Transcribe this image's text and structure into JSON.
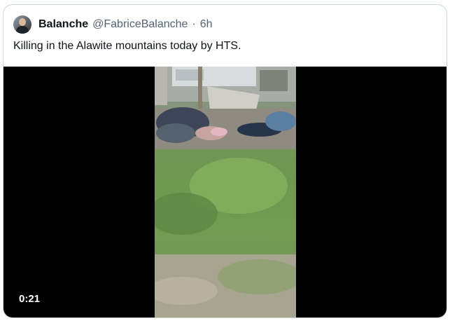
{
  "author": {
    "name": "Balanche",
    "handle": "@FabriceBalanche",
    "separator": "·",
    "time": "6h",
    "avatar_icon": "user-avatar"
  },
  "tweet": {
    "text": "Killing in the Alawite mountains today by HTS."
  },
  "video": {
    "duration": "0:21"
  },
  "colors": {
    "text_primary": "#0f1419",
    "text_secondary": "#536471",
    "border": "#cfd9de",
    "video_bg": "#000000"
  }
}
